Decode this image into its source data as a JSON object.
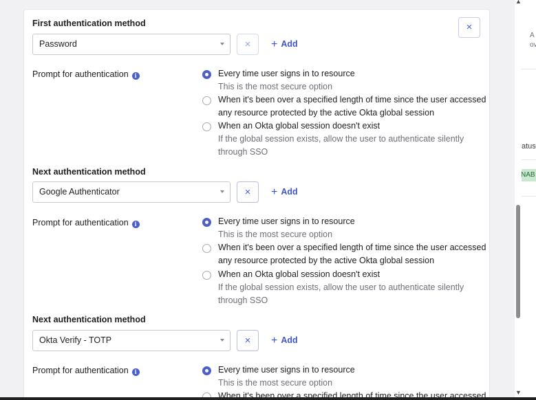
{
  "background": {
    "fragments": [
      "A",
      "ov",
      "atus",
      "NAB"
    ]
  },
  "modal": {
    "close_icon": "×",
    "first_method": {
      "title": "First authentication method",
      "selected": "Password",
      "remove_icon": "×",
      "add_label": "Add",
      "add_icon": "+"
    },
    "next_methods": [
      {
        "title": "Next authentication method",
        "selected": "Google Authenticator",
        "remove_icon": "×",
        "add_label": "Add",
        "add_icon": "+"
      },
      {
        "title": "Next authentication method",
        "selected": "Okta Verify - TOTP",
        "remove_icon": "×",
        "add_label": "Add",
        "add_icon": "+"
      }
    ],
    "prompt": {
      "label": "Prompt for authentication",
      "info_icon": "i",
      "option_every_time": "Every time user signs in to resource",
      "hint_every_time": "This is the most secure option",
      "option_length_line1": "When it's been over a specified length of time since the user accessed",
      "option_length_line2": "any resource protected by the active Okta global session",
      "option_no_session": "When an Okta global session doesn't exist",
      "hint_no_session_line1": "If the global session exists, allow the user to authenticate silently",
      "hint_no_session_line2": "through SSO"
    }
  },
  "scrollbar": {
    "up_arrow": "▲",
    "down_arrow": "▼"
  }
}
